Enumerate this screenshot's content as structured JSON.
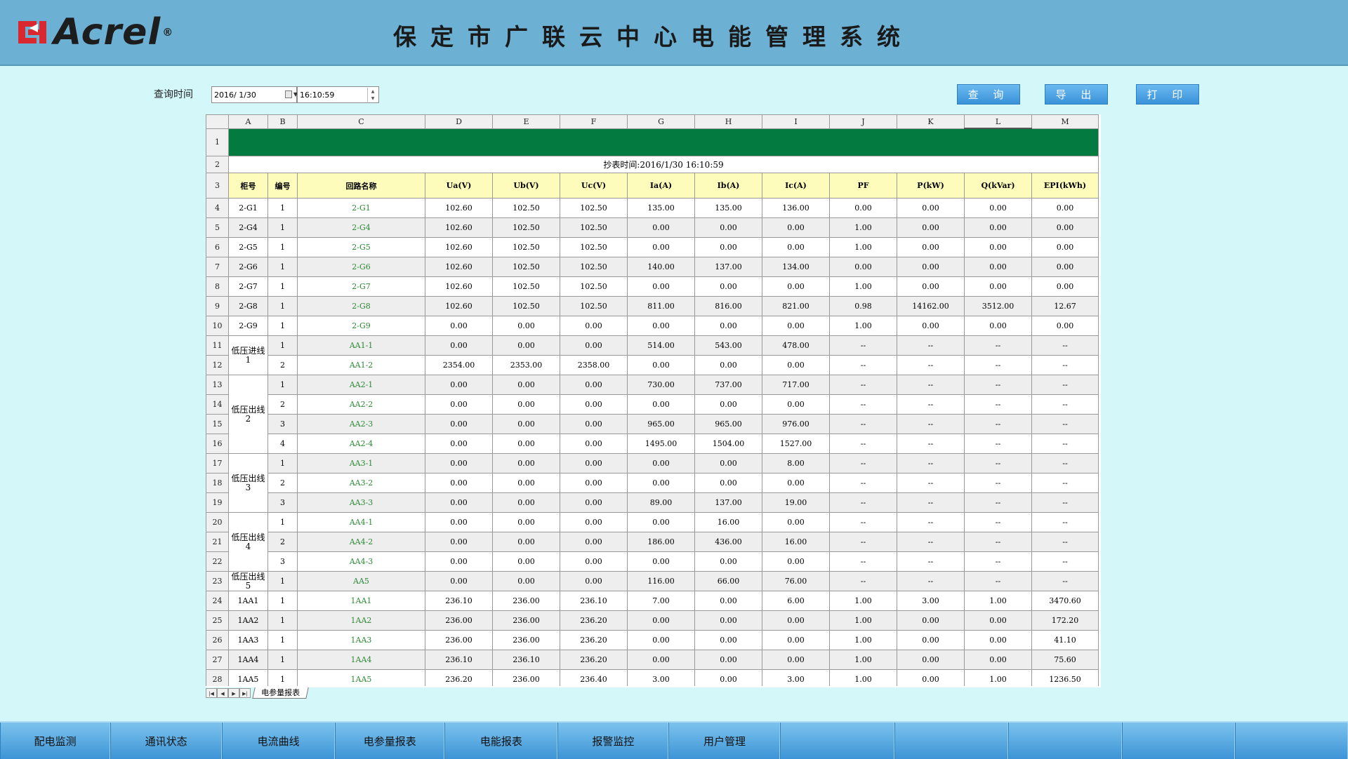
{
  "header": {
    "logo_text": "Acrel",
    "logo_reg": "®",
    "title": "保定市广联云中心电能管理系统"
  },
  "query": {
    "label": "查询时间",
    "date": "2016/ 1/30",
    "time": "16:10:59"
  },
  "buttons": {
    "query": "查 询",
    "export": "导 出",
    "print": "打 印"
  },
  "sheet": {
    "col_letters": [
      "A",
      "B",
      "C",
      "D",
      "E",
      "F",
      "G",
      "H",
      "I",
      "J",
      "K",
      "L",
      "M"
    ],
    "read_time": "抄表时间:2016/1/30 16:10:59",
    "headers": [
      "柜号",
      "编号",
      "回路名称",
      "Ua(V)",
      "Ub(V)",
      "Uc(V)",
      "Ia(A)",
      "Ib(A)",
      "Ic(A)",
      "PF",
      "P(kW)",
      "Q(kVar)",
      "EPI(kWh)"
    ],
    "groups": [
      {
        "start": 4,
        "span": 1,
        "label": "2-G1"
      },
      {
        "start": 5,
        "span": 1,
        "label": "2-G4"
      },
      {
        "start": 6,
        "span": 1,
        "label": "2-G5"
      },
      {
        "start": 7,
        "span": 1,
        "label": "2-G6"
      },
      {
        "start": 8,
        "span": 1,
        "label": "2-G7"
      },
      {
        "start": 9,
        "span": 1,
        "label": "2-G8"
      },
      {
        "start": 10,
        "span": 1,
        "label": "2-G9"
      },
      {
        "start": 11,
        "span": 2,
        "label": "低压进线1"
      },
      {
        "start": 13,
        "span": 4,
        "label": "低压出线2"
      },
      {
        "start": 17,
        "span": 3,
        "label": "低压出线3"
      },
      {
        "start": 20,
        "span": 3,
        "label": "低压出线4"
      },
      {
        "start": 23,
        "span": 1,
        "label": "低压出线5"
      },
      {
        "start": 24,
        "span": 1,
        "label": "1AA1"
      },
      {
        "start": 25,
        "span": 1,
        "label": "1AA2"
      },
      {
        "start": 26,
        "span": 1,
        "label": "1AA3"
      },
      {
        "start": 27,
        "span": 1,
        "label": "1AA4"
      },
      {
        "start": 28,
        "span": 1,
        "label": "1AA5"
      }
    ],
    "rows": [
      [
        "1",
        "2-G1",
        "102.60",
        "102.50",
        "102.50",
        "135.00",
        "135.00",
        "136.00",
        "0.00",
        "0.00",
        "0.00",
        "0.00"
      ],
      [
        "1",
        "2-G4",
        "102.60",
        "102.50",
        "102.50",
        "0.00",
        "0.00",
        "0.00",
        "1.00",
        "0.00",
        "0.00",
        "0.00"
      ],
      [
        "1",
        "2-G5",
        "102.60",
        "102.50",
        "102.50",
        "0.00",
        "0.00",
        "0.00",
        "1.00",
        "0.00",
        "0.00",
        "0.00"
      ],
      [
        "1",
        "2-G6",
        "102.60",
        "102.50",
        "102.50",
        "140.00",
        "137.00",
        "134.00",
        "0.00",
        "0.00",
        "0.00",
        "0.00"
      ],
      [
        "1",
        "2-G7",
        "102.60",
        "102.50",
        "102.50",
        "0.00",
        "0.00",
        "0.00",
        "1.00",
        "0.00",
        "0.00",
        "0.00"
      ],
      [
        "1",
        "2-G8",
        "102.60",
        "102.50",
        "102.50",
        "811.00",
        "816.00",
        "821.00",
        "0.98",
        "14162.00",
        "3512.00",
        "12.67"
      ],
      [
        "1",
        "2-G9",
        "0.00",
        "0.00",
        "0.00",
        "0.00",
        "0.00",
        "0.00",
        "1.00",
        "0.00",
        "0.00",
        "0.00"
      ],
      [
        "1",
        "AA1-1",
        "0.00",
        "0.00",
        "0.00",
        "514.00",
        "543.00",
        "478.00",
        "--",
        "--",
        "--",
        "--"
      ],
      [
        "2",
        "AA1-2",
        "2354.00",
        "2353.00",
        "2358.00",
        "0.00",
        "0.00",
        "0.00",
        "--",
        "--",
        "--",
        "--"
      ],
      [
        "1",
        "AA2-1",
        "0.00",
        "0.00",
        "0.00",
        "730.00",
        "737.00",
        "717.00",
        "--",
        "--",
        "--",
        "--"
      ],
      [
        "2",
        "AA2-2",
        "0.00",
        "0.00",
        "0.00",
        "0.00",
        "0.00",
        "0.00",
        "--",
        "--",
        "--",
        "--"
      ],
      [
        "3",
        "AA2-3",
        "0.00",
        "0.00",
        "0.00",
        "965.00",
        "965.00",
        "976.00",
        "--",
        "--",
        "--",
        "--"
      ],
      [
        "4",
        "AA2-4",
        "0.00",
        "0.00",
        "0.00",
        "1495.00",
        "1504.00",
        "1527.00",
        "--",
        "--",
        "--",
        "--"
      ],
      [
        "1",
        "AA3-1",
        "0.00",
        "0.00",
        "0.00",
        "0.00",
        "0.00",
        "8.00",
        "--",
        "--",
        "--",
        "--"
      ],
      [
        "2",
        "AA3-2",
        "0.00",
        "0.00",
        "0.00",
        "0.00",
        "0.00",
        "0.00",
        "--",
        "--",
        "--",
        "--"
      ],
      [
        "3",
        "AA3-3",
        "0.00",
        "0.00",
        "0.00",
        "89.00",
        "137.00",
        "19.00",
        "--",
        "--",
        "--",
        "--"
      ],
      [
        "1",
        "AA4-1",
        "0.00",
        "0.00",
        "0.00",
        "0.00",
        "16.00",
        "0.00",
        "--",
        "--",
        "--",
        "--"
      ],
      [
        "2",
        "AA4-2",
        "0.00",
        "0.00",
        "0.00",
        "186.00",
        "436.00",
        "16.00",
        "--",
        "--",
        "--",
        "--"
      ],
      [
        "3",
        "AA4-3",
        "0.00",
        "0.00",
        "0.00",
        "0.00",
        "0.00",
        "0.00",
        "--",
        "--",
        "--",
        "--"
      ],
      [
        "1",
        "AA5",
        "0.00",
        "0.00",
        "0.00",
        "116.00",
        "66.00",
        "76.00",
        "--",
        "--",
        "--",
        "--"
      ],
      [
        "1",
        "1AA1",
        "236.10",
        "236.00",
        "236.10",
        "7.00",
        "0.00",
        "6.00",
        "1.00",
        "3.00",
        "1.00",
        "3470.60"
      ],
      [
        "1",
        "1AA2",
        "236.00",
        "236.00",
        "236.20",
        "0.00",
        "0.00",
        "0.00",
        "1.00",
        "0.00",
        "0.00",
        "172.20"
      ],
      [
        "1",
        "1AA3",
        "236.00",
        "236.00",
        "236.20",
        "0.00",
        "0.00",
        "0.00",
        "1.00",
        "0.00",
        "0.00",
        "41.10"
      ],
      [
        "1",
        "1AA4",
        "236.10",
        "236.10",
        "236.20",
        "0.00",
        "0.00",
        "0.00",
        "1.00",
        "0.00",
        "0.00",
        "75.60"
      ],
      [
        "1",
        "1AA5",
        "236.20",
        "236.00",
        "236.40",
        "3.00",
        "0.00",
        "3.00",
        "1.00",
        "0.00",
        "1.00",
        "1236.50"
      ]
    ],
    "sheet_tab": "电参量报表",
    "nav_buttons": [
      "|◀",
      "◀",
      "▶",
      "▶|"
    ]
  },
  "nav": [
    "配电监测",
    "通讯状态",
    "电流曲线",
    "电参量报表",
    "电能报表",
    "报警监控",
    "用户管理",
    "",
    "",
    "",
    "",
    ""
  ]
}
